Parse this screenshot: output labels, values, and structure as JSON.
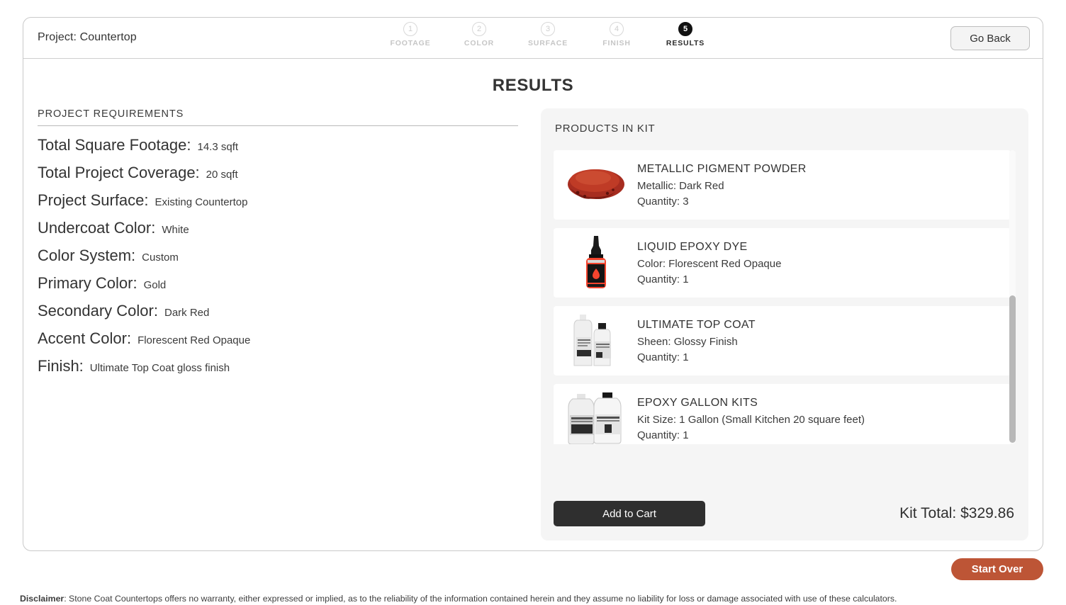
{
  "topbar": {
    "project_title": "Project: Countertop",
    "go_back_label": "Go Back",
    "steps": [
      {
        "number": "1",
        "label": "FOOTAGE",
        "active": false
      },
      {
        "number": "2",
        "label": "COLOR",
        "active": false
      },
      {
        "number": "3",
        "label": "SURFACE",
        "active": false
      },
      {
        "number": "4",
        "label": "FINISH",
        "active": false
      },
      {
        "number": "5",
        "label": "RESULTS",
        "active": true
      }
    ]
  },
  "page": {
    "title": "RESULTS"
  },
  "requirements": {
    "section_label": "PROJECT REQUIREMENTS",
    "rows": [
      {
        "label": "Total Square Footage:",
        "value": "14.3 sqft"
      },
      {
        "label": "Total Project Coverage:",
        "value": "20 sqft"
      },
      {
        "label": "Project Surface:",
        "value": "Existing Countertop"
      },
      {
        "label": "Undercoat Color:",
        "value": "White"
      },
      {
        "label": "Color System:",
        "value": "Custom"
      },
      {
        "label": "Primary Color:",
        "value": "Gold"
      },
      {
        "label": "Secondary Color:",
        "value": "Dark Red"
      },
      {
        "label": "Accent Color:",
        "value": "Florescent Red Opaque"
      },
      {
        "label": "Finish:",
        "value": "Ultimate Top Coat gloss finish"
      }
    ]
  },
  "kit": {
    "heading": "PRODUCTS IN KIT",
    "products": [
      {
        "name": "METALLIC PIGMENT POWDER",
        "attribute": "Metallic: Dark Red",
        "quantity": "Quantity: 3",
        "thumb": "pigment-powder-icon"
      },
      {
        "name": "LIQUID EPOXY DYE",
        "attribute": "Color: Florescent Red Opaque",
        "quantity": "Quantity: 1",
        "thumb": "dye-bottle-icon"
      },
      {
        "name": "ULTIMATE TOP COAT",
        "attribute": "Sheen: Glossy Finish",
        "quantity": "Quantity: 1",
        "thumb": "top-coat-bottles-icon"
      },
      {
        "name": "EPOXY GALLON KITS",
        "attribute": "Kit Size: 1 Gallon (Small Kitchen 20 square feet)",
        "quantity": "Quantity: 1",
        "thumb": "gallon-jugs-icon"
      }
    ],
    "add_to_cart_label": "Add to Cart",
    "total_label": "Kit Total: $329.86"
  },
  "footer": {
    "start_over_label": "Start Over",
    "disclaimer_bold": "Disclaimer",
    "disclaimer_text": ": Stone Coat Countertops offers no warranty, either expressed or implied, as to the reliability of the information contained herein and they assume no liability for loss or damage associated with use of these calculators."
  },
  "colors": {
    "accent": "#bd5536",
    "dark_button": "#2f2f2f",
    "panel_bg": "#f5f5f5"
  }
}
